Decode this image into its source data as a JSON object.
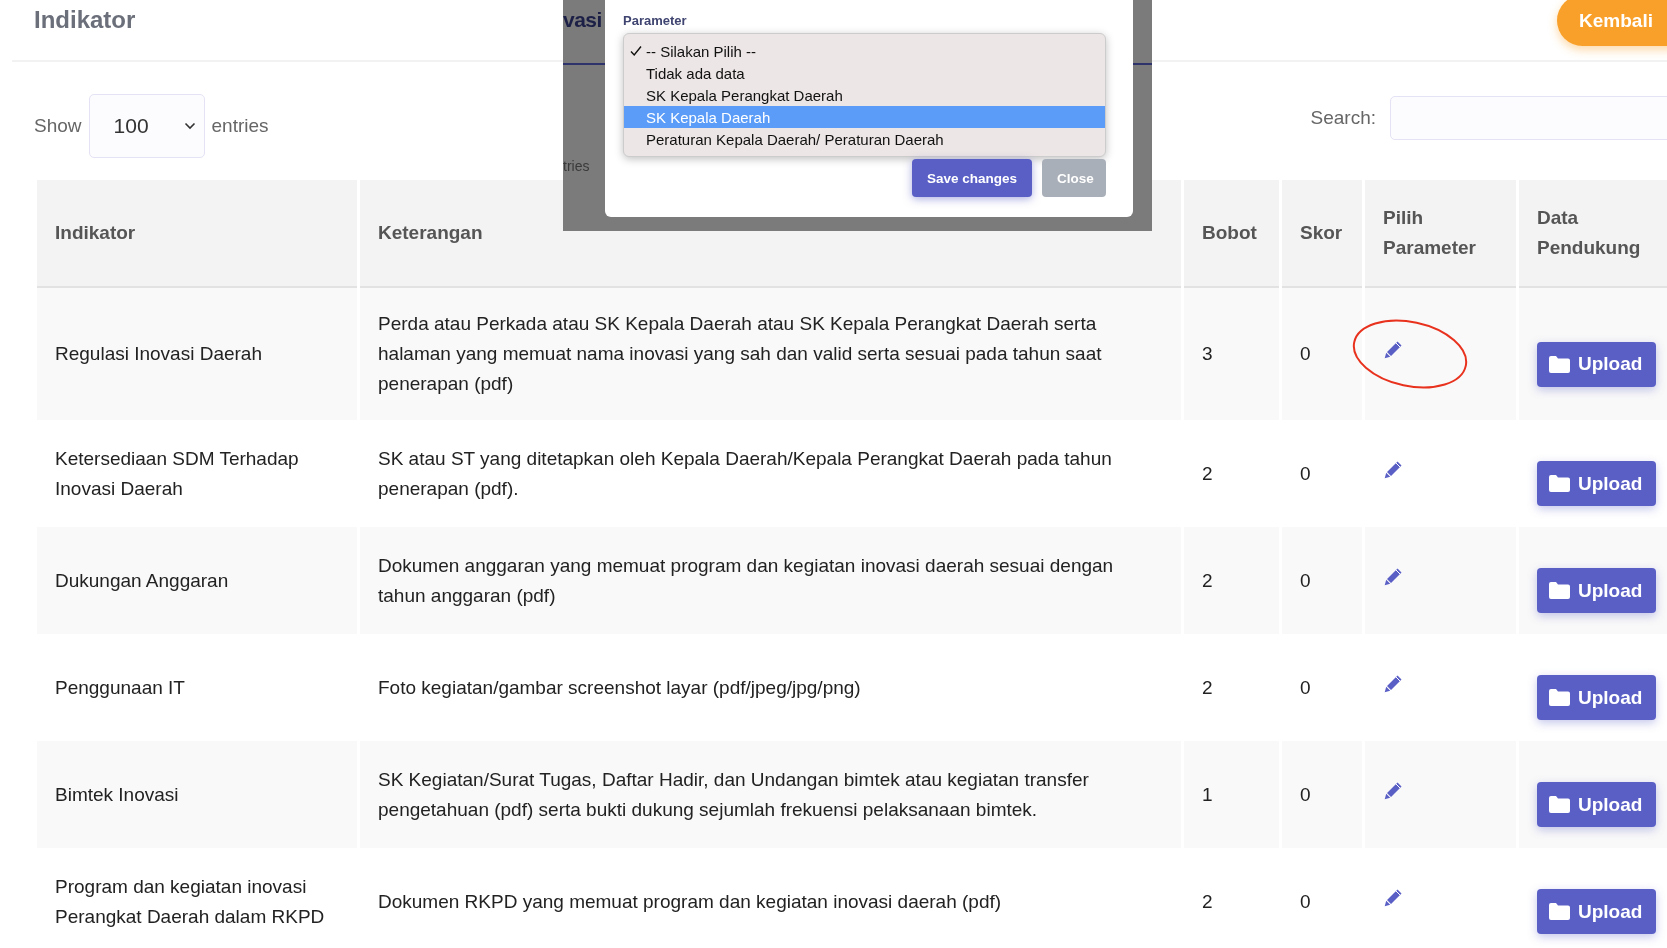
{
  "page": {
    "title": "Indikator",
    "back_button": "Kembali"
  },
  "length_menu": {
    "show_label": "Show",
    "value": "100",
    "entries_label": "entries"
  },
  "search": {
    "label": "Search:"
  },
  "table": {
    "columns": [
      "Indikator",
      "Keterangan",
      "Bobot",
      "Skor",
      "Pilih Parameter",
      "Data Pendukung"
    ],
    "rows": [
      {
        "indikator": "Regulasi Inovasi Daerah",
        "keterangan": "Perda atau Perkada atau SK Kepala Daerah atau SK Kepala Perangkat Daerah serta halaman yang memuat nama inovasi yang sah dan valid serta sesuai pada tahun saat penerapan (pdf)",
        "bobot": "3",
        "skor": "0",
        "upload": "Upload",
        "annotated": true
      },
      {
        "indikator": "Ketersediaan SDM Terhadap Inovasi Daerah",
        "keterangan": "SK atau ST yang ditetapkan oleh Kepala Daerah/Kepala Perangkat Daerah pada tahun penerapan (pdf).",
        "bobot": "2",
        "skor": "0",
        "upload": "Upload",
        "annotated": false
      },
      {
        "indikator": "Dukungan Anggaran",
        "keterangan": "Dokumen anggaran yang memuat program dan kegiatan inovasi daerah sesuai dengan tahun anggaran (pdf)",
        "bobot": "2",
        "skor": "0",
        "upload": "Upload",
        "annotated": false
      },
      {
        "indikator": "Penggunaan IT",
        "keterangan": "Foto kegiatan/gambar screenshot layar (pdf/jpeg/jpg/png)",
        "bobot": "2",
        "skor": "0",
        "upload": "Upload",
        "annotated": false
      },
      {
        "indikator": "Bimtek Inovasi",
        "keterangan": "SK Kegiatan/Surat Tugas, Daftar Hadir, dan Undangan bimtek atau kegiatan transfer pengetahuan (pdf) serta bukti dukung sejumlah frekuensi pelaksanaan bimtek.",
        "bobot": "1",
        "skor": "0",
        "upload": "Upload",
        "annotated": false
      },
      {
        "indikator": "Program dan kegiatan inovasi Perangkat Daerah dalam RKPD",
        "keterangan": "Dokumen RKPD yang memuat program dan kegiatan inovasi daerah (pdf)",
        "bobot": "2",
        "skor": "0",
        "upload": "Upload",
        "annotated": false
      }
    ]
  },
  "modal": {
    "backdrop_texts": [
      "vasi",
      "tries"
    ],
    "label": "Parameter",
    "options": [
      {
        "label": "-- Silakan Pilih --",
        "checked": true,
        "selected": false
      },
      {
        "label": "Tidak ada data",
        "checked": false,
        "selected": false
      },
      {
        "label": "SK Kepala Perangkat Daerah",
        "checked": false,
        "selected": false
      },
      {
        "label": "SK Kepala Daerah",
        "checked": false,
        "selected": true
      },
      {
        "label": "Peraturan Kepala Daerah/ Peraturan Daerah",
        "checked": false,
        "selected": false
      }
    ],
    "buttons": [
      {
        "label": "Save changes",
        "kind": "primary"
      },
      {
        "label": "Close",
        "kind": "secondary"
      }
    ]
  }
}
